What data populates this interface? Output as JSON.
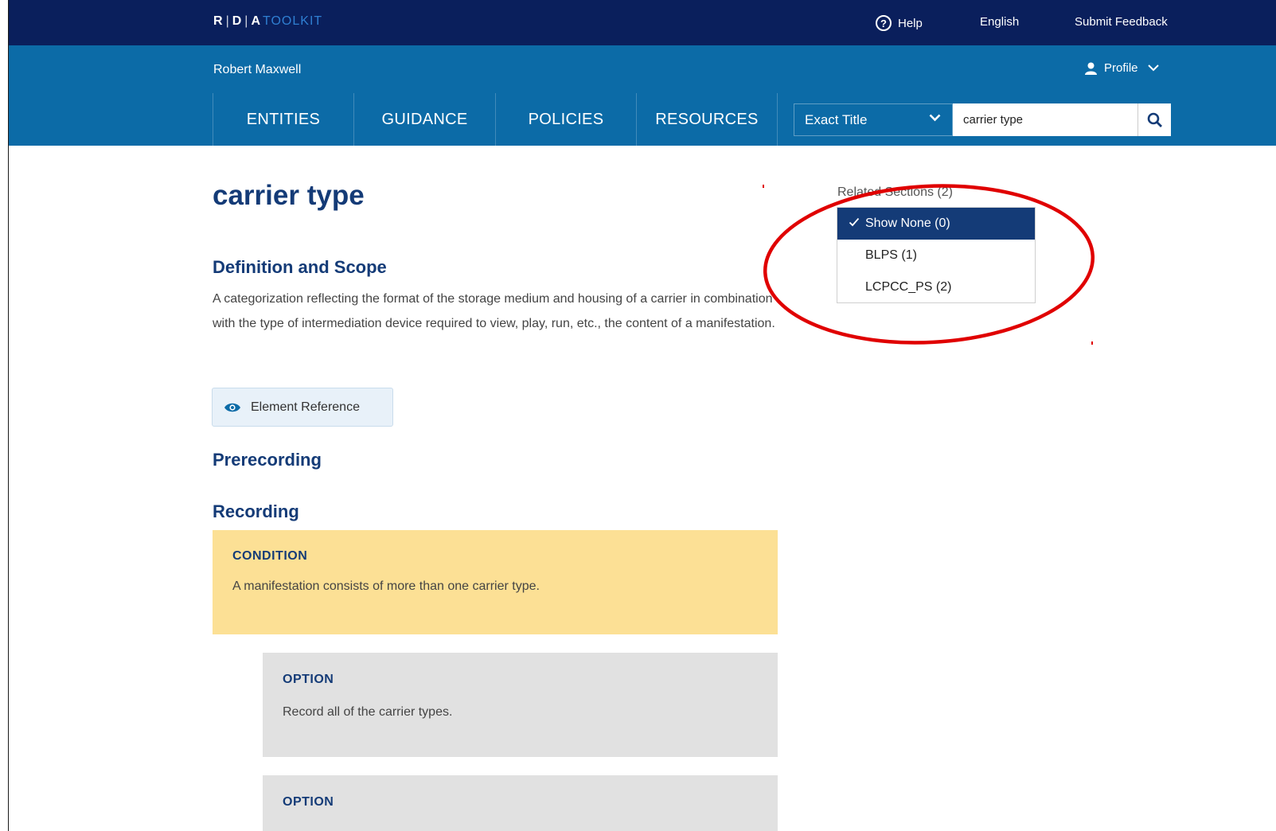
{
  "topbar": {
    "brand": {
      "r": "R",
      "d": "D",
      "a": "A",
      "toolkit": "TOOLKIT",
      "separator": "|"
    },
    "help_label": "Help",
    "language_label": "English",
    "feedback_label": "Submit Feedback"
  },
  "header": {
    "user_name": "Robert Maxwell",
    "profile_label": "Profile",
    "nav": [
      {
        "label": "ENTITIES"
      },
      {
        "label": "GUIDANCE"
      },
      {
        "label": "POLICIES"
      },
      {
        "label": "RESOURCES"
      }
    ],
    "search": {
      "type_selected": "Exact Title",
      "query_value": "carrier type"
    }
  },
  "main": {
    "title": "carrier type",
    "definition_heading": "Definition and Scope",
    "definition_text": "A categorization reflecting the format of the storage medium and housing of a carrier in combination with the type of intermediation device required to view, play, run, etc., the content of a manifestation.",
    "element_reference_label": "Element Reference",
    "prerecording_heading": "Prerecording",
    "recording_heading": "Recording",
    "condition": {
      "label": "CONDITION",
      "text": "A manifestation consists of more than one carrier type."
    },
    "options": [
      {
        "label": "OPTION",
        "text": "Record all of the carrier types."
      },
      {
        "label": "OPTION",
        "text": ""
      }
    ]
  },
  "related_sections": {
    "label": "Related Sections (2)",
    "items": [
      {
        "label": "Show None (0)",
        "selected": true
      },
      {
        "label": "BLPS (1)",
        "selected": false
      },
      {
        "label": "LCPCC_PS (2)",
        "selected": false
      }
    ]
  },
  "colors": {
    "topbar_bg": "#0a1f5c",
    "header_bg": "#0c6ba7",
    "heading_text": "#143b77",
    "condition_bg": "#fce095",
    "option_bg": "#e1e1e1",
    "selected_item_bg": "#143b77",
    "annotation_red": "#e00000"
  },
  "icons": {
    "help": "question-circle-icon",
    "profile": "user-icon",
    "chevron": "chevron-down-icon",
    "search": "search-icon",
    "element_reference": "eye-icon",
    "check": "check-icon"
  }
}
